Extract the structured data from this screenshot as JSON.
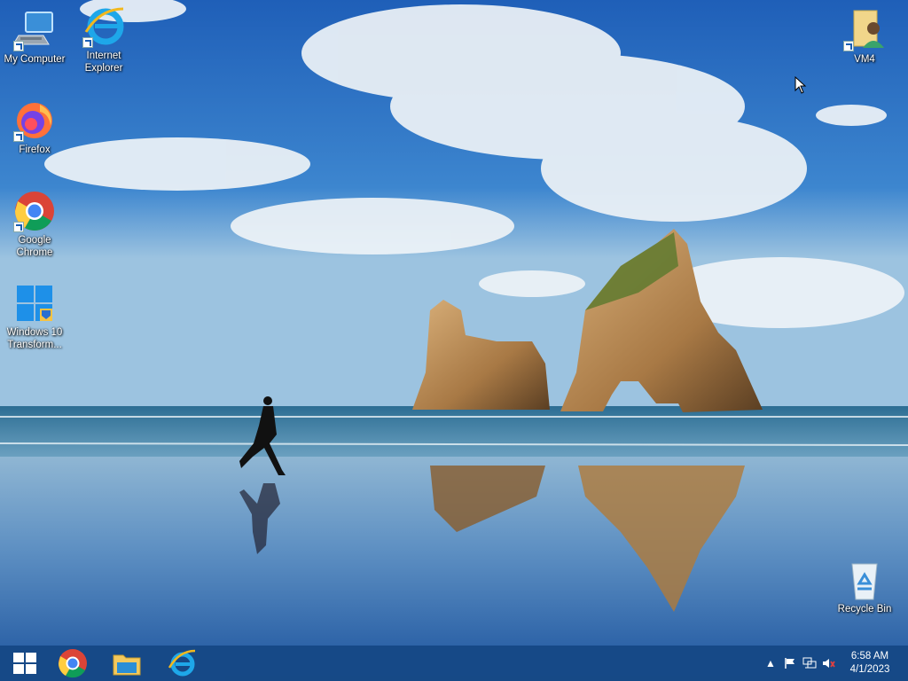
{
  "desktop": {
    "icons": {
      "my_computer": "My Computer",
      "internet_explorer": "Internet Explorer",
      "firefox": "Firefox",
      "google_chrome": "Google Chrome",
      "windows10_transform": "Windows 10 Transform...",
      "vm4": "VM4",
      "recycle_bin": "Recycle Bin"
    }
  },
  "taskbar": {
    "pinned": [
      "start",
      "google-chrome",
      "file-explorer",
      "internet-explorer"
    ],
    "tray": {
      "time": "6:58 AM",
      "date": "4/1/2023"
    },
    "colors": {
      "taskbar": "#144682",
      "accent": "#1a5fb4"
    }
  }
}
